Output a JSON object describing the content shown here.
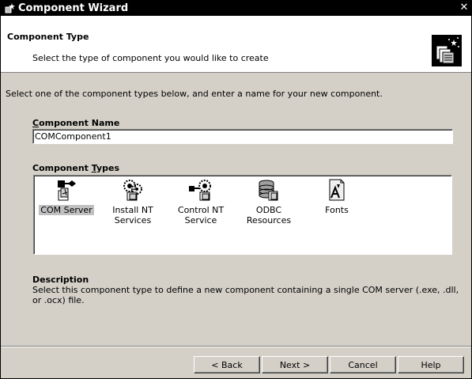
{
  "window": {
    "title": "Component Wizard"
  },
  "header": {
    "title": "Component Type",
    "subtitle": "Select the type of component you would like to create"
  },
  "intro": "Select one of the component types below, and enter a name for your new component.",
  "name_field": {
    "label_prefix": "C",
    "label_rest": "omponent Name",
    "value": "COMComponent1"
  },
  "types": {
    "label_prefix": "Component ",
    "label_access": "T",
    "label_rest": "ypes",
    "items": [
      {
        "line1": "COM Server",
        "line2": "",
        "icon": "com-server-icon",
        "selected": true
      },
      {
        "line1": "Install NT",
        "line2": "Services",
        "icon": "install-nt-services-icon",
        "selected": false
      },
      {
        "line1": "Control NT",
        "line2": "Service",
        "icon": "control-nt-service-icon",
        "selected": false
      },
      {
        "line1": "ODBC",
        "line2": "Resources",
        "icon": "odbc-resources-icon",
        "selected": false
      },
      {
        "line1": "Fonts",
        "line2": "",
        "icon": "fonts-icon",
        "selected": false
      }
    ]
  },
  "description": {
    "label": "Description",
    "text": "Select this component type to define a new component containing a single COM server (.exe, .dll, or .ocx) file."
  },
  "buttons": {
    "back": "< Back",
    "next": "Next >",
    "cancel": "Cancel",
    "help": "Help"
  }
}
